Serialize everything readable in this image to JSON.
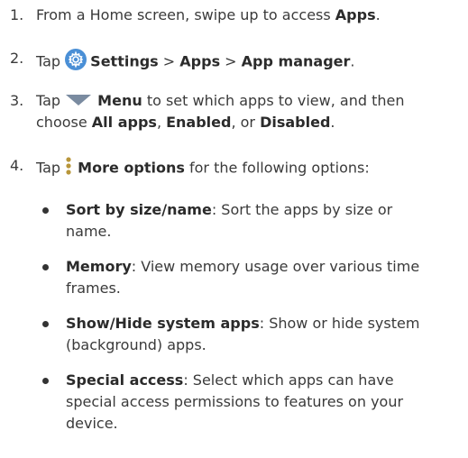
{
  "steps": [
    {
      "num": "1.",
      "pre": "From a Home screen, swipe up to access ",
      "bold": "Apps",
      "post": "."
    },
    {
      "num": "2.",
      "pre": "Tap ",
      "settings_icon": "settings-gear-icon",
      "b1": "Settings",
      "sep1": " > ",
      "b2": "Apps",
      "sep2": " > ",
      "b3": "App manager",
      "post": "."
    },
    {
      "num": "3.",
      "line1_pre": "Tap ",
      "menu_icon": "menu-triangle-icon",
      "line1_bold": "Menu",
      "line1_post": " to set which apps to view, and then",
      "line2_pre": "choose ",
      "b_all": "All apps",
      "c1": ", ",
      "b_enabled": "Enabled",
      "c2": ", or ",
      "b_disabled": "Disabled",
      "post": "."
    },
    {
      "num": "4.",
      "pre": "Tap ",
      "more_icon": "more-options-icon",
      "bold": "More options",
      "post": " for the following options:"
    }
  ],
  "options": [
    {
      "bold": "Sort by size/name",
      "l1": ": Sort the apps by size or",
      "l2": "name."
    },
    {
      "bold": "Memory",
      "l1": ": View memory usage over various time",
      "l2": "frames."
    },
    {
      "bold": "Show/Hide system apps",
      "l1": ": Show or hide system",
      "l2": "(background) apps."
    },
    {
      "bold": "Special access",
      "l1": ": Select which apps can have",
      "l2": "special access permissions to features on your",
      "l3": "device."
    }
  ],
  "colors": {
    "text": "#3a3a3a",
    "settings_icon_bg": "#4a8fd6",
    "menu_icon": "#7a8ba0"
  }
}
